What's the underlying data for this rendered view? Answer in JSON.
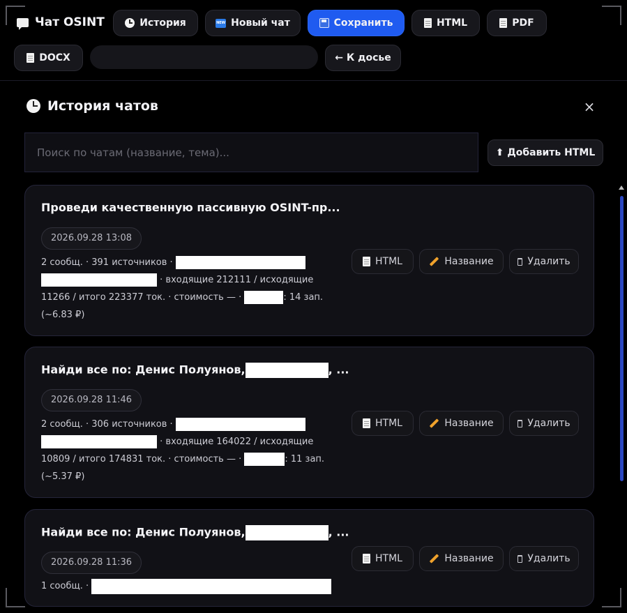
{
  "toolbar": {
    "app_title": "Чат OSINT",
    "history_label": "История",
    "new_chat_label": "Новый чат",
    "new_chat_icon_text": "NEW",
    "save_label": "Сохранить",
    "html_label": "HTML",
    "pdf_label": "PDF",
    "docx_label": "DOCX",
    "back_label": "← К досье"
  },
  "panel": {
    "title": "История чатов",
    "close_glyph": "×",
    "search_placeholder": "Поиск по чатам (название, тема)...",
    "add_html_label": "⬆ Добавить HTML"
  },
  "chats": [
    {
      "title": "Проведи качественную пассивную OSINT-пр...",
      "date": "2026.09.28 13:08",
      "meta_a": "2 сообщ. · 391 источников ·",
      "meta_b": "· входящие 212111 / исходящие 11266 / итого 223377 ток. · стоимость — ·",
      "meta_c": ": 14 зап. (~6.83 ₽)"
    },
    {
      "title_a": "Найди все по: Денис Полуянов,",
      "title_b": ", ...",
      "date": "2026.09.28 11:46",
      "meta_a": "2 сообщ. · 306 источников ·",
      "meta_b": "· входящие 164022 / исходящие 10809 / итого 174831 ток. · стоимость — ·",
      "meta_c": ": 11 зап. (~5.37 ₽)"
    },
    {
      "title_a": "Найди все по: Денис Полуянов,",
      "title_b": ", ...",
      "date": "2026.09.28 11:36",
      "meta_a": "1 сообщ. ·"
    }
  ],
  "card_actions": {
    "html_label": "HTML",
    "rename_label": "Название",
    "delete_label": "Удалить"
  },
  "icons": {
    "history": "clock-icon",
    "new_chat": "new-badge-icon",
    "save": "floppy-disk-icon",
    "export": "document-icon",
    "rename": "pencil-icon",
    "delete": "trash-icon"
  },
  "colors": {
    "accent": "#1f5bf0",
    "background": "#000000",
    "card": "#111116",
    "scrollbar": "#2b47c0"
  }
}
